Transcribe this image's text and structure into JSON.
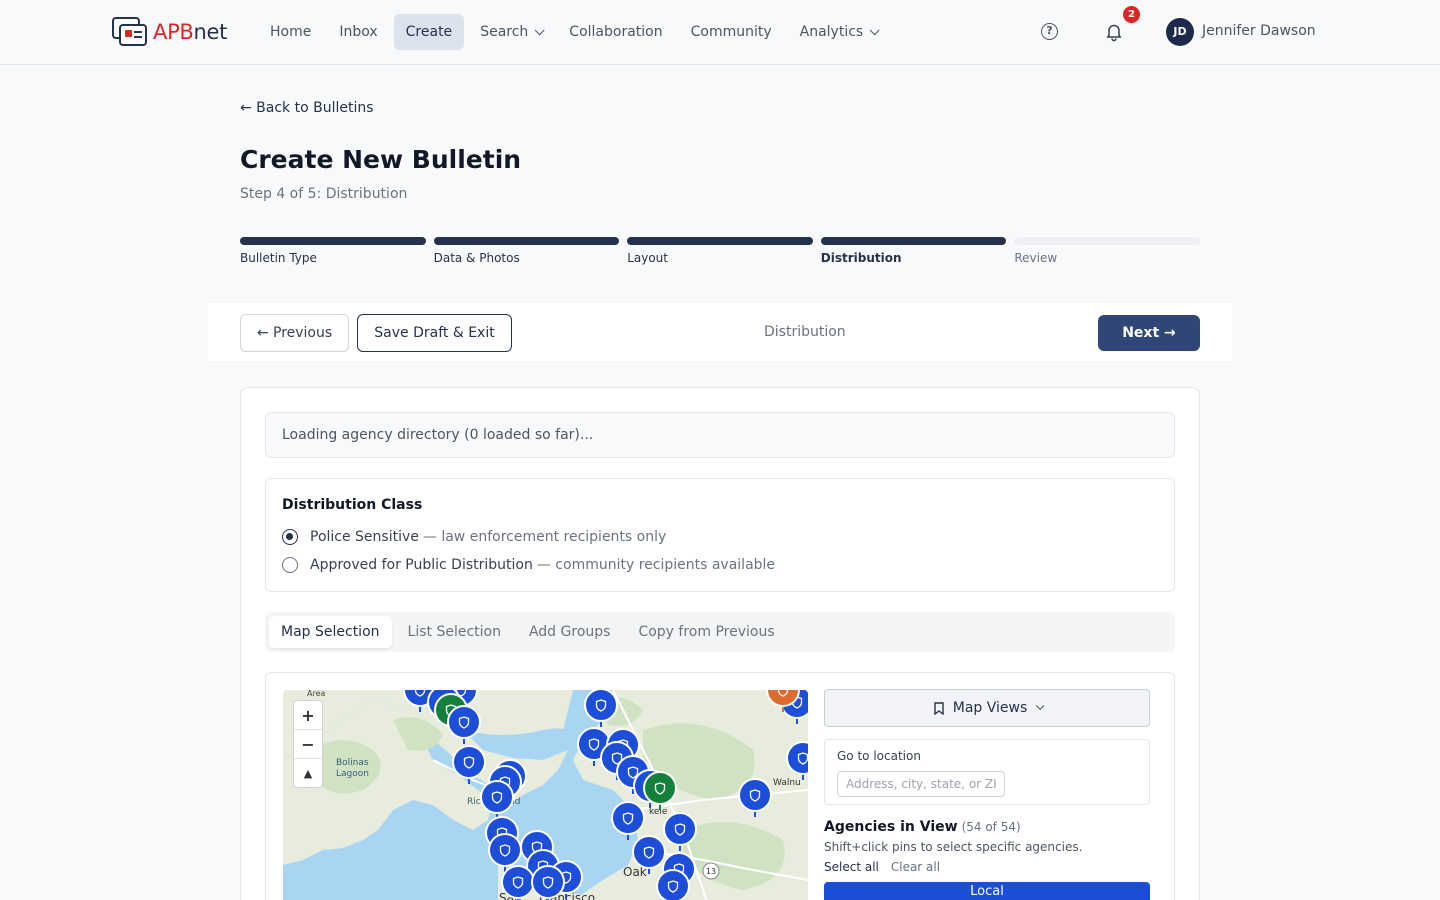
{
  "nav": {
    "brand_a": "APB",
    "brand_b": "net",
    "links": [
      {
        "label": "Home"
      },
      {
        "label": "Inbox"
      },
      {
        "label": "Create"
      },
      {
        "label": "Search"
      },
      {
        "label": "Collaboration"
      },
      {
        "label": "Community"
      },
      {
        "label": "Analytics"
      }
    ],
    "help_glyph": "?",
    "notification_count": "2",
    "avatar_initials": "JD",
    "user_name": "Jennifer Dawson"
  },
  "header": {
    "back_link": "← Back to Bulletins",
    "title": "Create New Bulletin",
    "subtitle": "Step 4 of 5: Distribution"
  },
  "steps": [
    {
      "label": "Bulletin Type"
    },
    {
      "label": "Data & Photos"
    },
    {
      "label": "Layout"
    },
    {
      "label": "Distribution"
    },
    {
      "label": "Review"
    }
  ],
  "actions": {
    "previous": "← Previous",
    "save": "Save Draft & Exit",
    "center_label": "Distribution",
    "next": "Next →"
  },
  "loading_text": "Loading agency directory (0 loaded so far)...",
  "distribution_class": {
    "title": "Distribution Class",
    "options": [
      {
        "label": "Police Sensitive",
        "desc": "— law enforcement recipients only"
      },
      {
        "label": "Approved for Public Distribution",
        "desc": "— community recipients available"
      }
    ]
  },
  "tabs": [
    {
      "label": "Map Selection"
    },
    {
      "label": "List Selection"
    },
    {
      "label": "Add Groups"
    },
    {
      "label": "Copy from Previous"
    }
  ],
  "map": {
    "zoom_in": "+",
    "zoom_out": "−",
    "reset": "▲",
    "place_labels": [
      "Area",
      "Bolinas",
      "Lagoon",
      "Rich",
      "nd",
      "Walnu",
      "kele",
      "Oak",
      "13",
      "San",
      "Francisco"
    ]
  },
  "side": {
    "map_views": "Map Views",
    "goto_label": "Go to location",
    "goto_placeholder": "Address, city, state, or ZIP",
    "agencies_title": "Agencies in View",
    "agencies_count": "(54 of 54)",
    "help": "Shift+click pins to select specific agencies.",
    "select_all": "Select all",
    "clear_all": "Clear all",
    "local": "Local"
  },
  "colors": {
    "navy": "#25324b",
    "accent_red": "#dc2626",
    "next_button": "#2f4677",
    "pin_police": "#1d4ed8",
    "pin_school": "#15803d",
    "water": "#a8d5f2",
    "land": "#e9ecdf"
  }
}
